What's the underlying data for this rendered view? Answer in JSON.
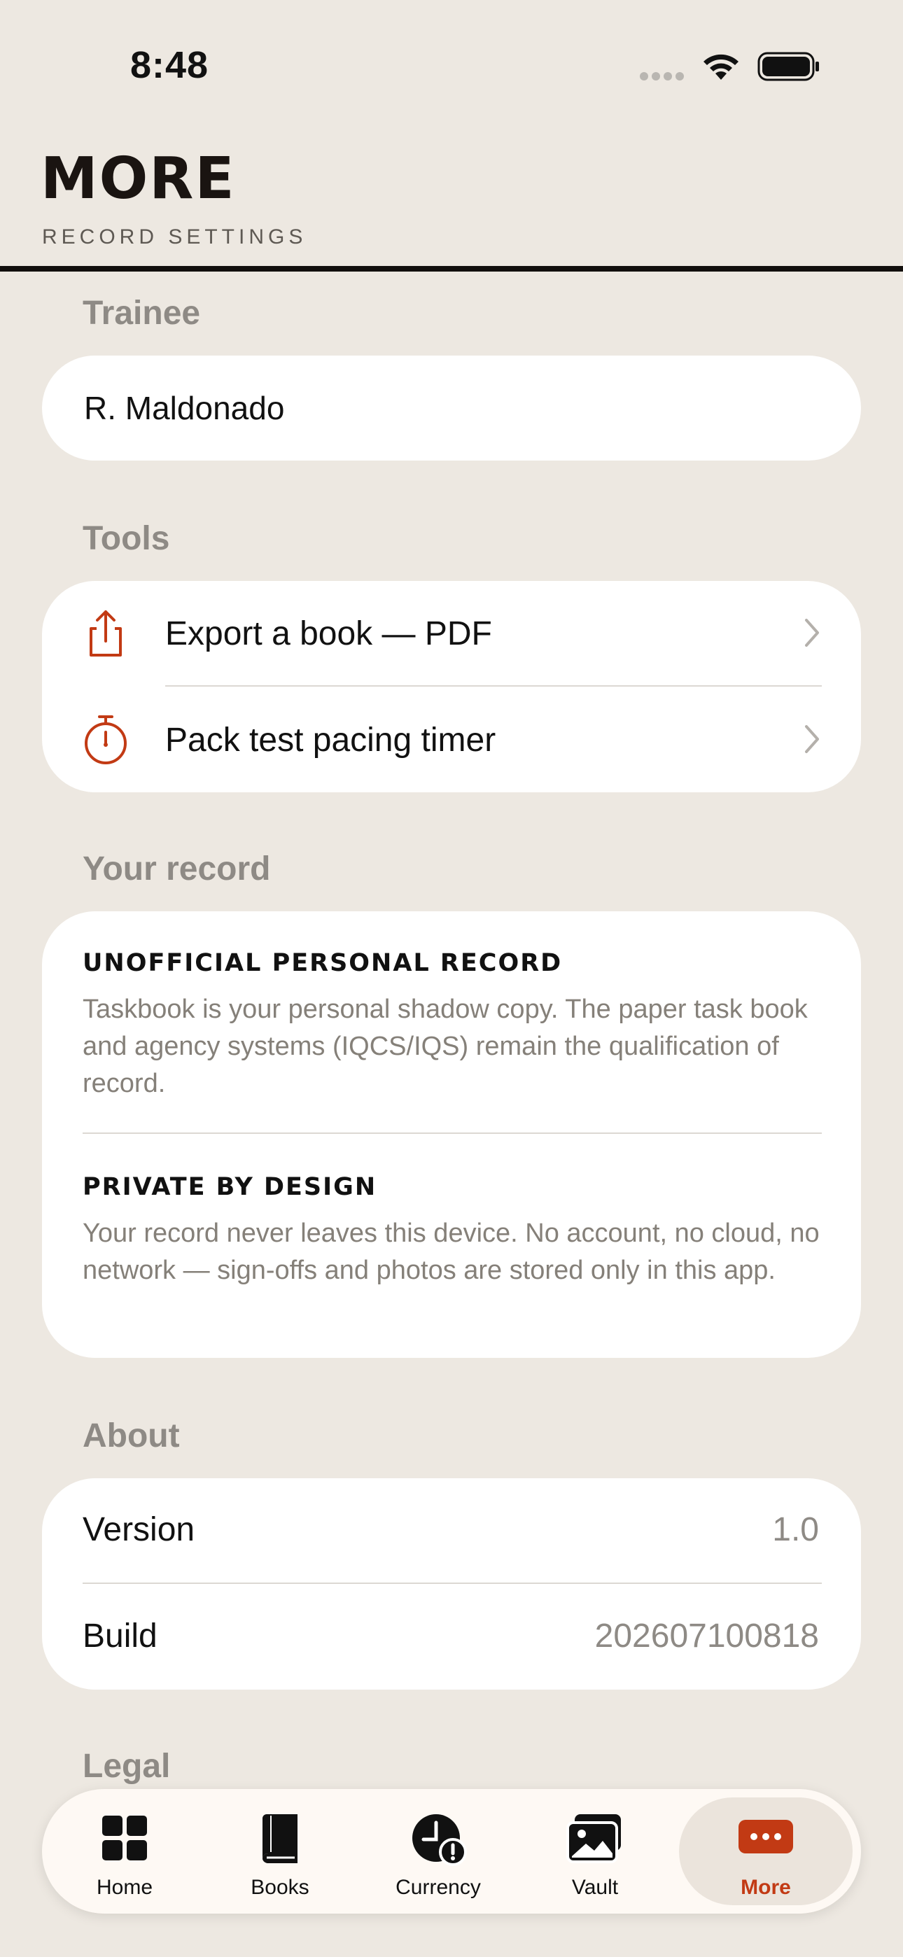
{
  "status_bar": {
    "time": "8:48"
  },
  "header": {
    "title": "MORE",
    "subtitle": "RECORD SETTINGS"
  },
  "trainee": {
    "label": "Trainee",
    "name": "R. Maldonado"
  },
  "tools": {
    "label": "Tools",
    "items": [
      {
        "label": "Export a book — PDF",
        "icon": "share-icon"
      },
      {
        "label": "Pack test pacing timer",
        "icon": "stopwatch-icon"
      }
    ]
  },
  "record": {
    "label": "Your record",
    "blocks": [
      {
        "heading": "UNOFFICIAL PERSONAL RECORD",
        "body": "Taskbook is your personal shadow copy. The paper task book and agency systems (IQCS/IQS) remain the qualification of record."
      },
      {
        "heading": "PRIVATE BY DESIGN",
        "body": "Your record never leaves this device. No account, no cloud, no network — sign-offs and photos are stored only in this app."
      }
    ]
  },
  "about": {
    "label": "About",
    "rows": [
      {
        "key": "Version",
        "value": "1.0"
      },
      {
        "key": "Build",
        "value": "202607100818"
      }
    ]
  },
  "legal": {
    "label": "Legal"
  },
  "tabbar": {
    "items": [
      {
        "label": "Home",
        "icon": "grid-icon"
      },
      {
        "label": "Books",
        "icon": "book-icon"
      },
      {
        "label": "Currency",
        "icon": "clock-alert-icon"
      },
      {
        "label": "Vault",
        "icon": "photos-icon"
      },
      {
        "label": "More",
        "icon": "ellipsis-icon",
        "selected": true
      }
    ]
  },
  "colors": {
    "accent": "#c23a14",
    "background": "#ede8e1",
    "card": "#ffffff"
  }
}
